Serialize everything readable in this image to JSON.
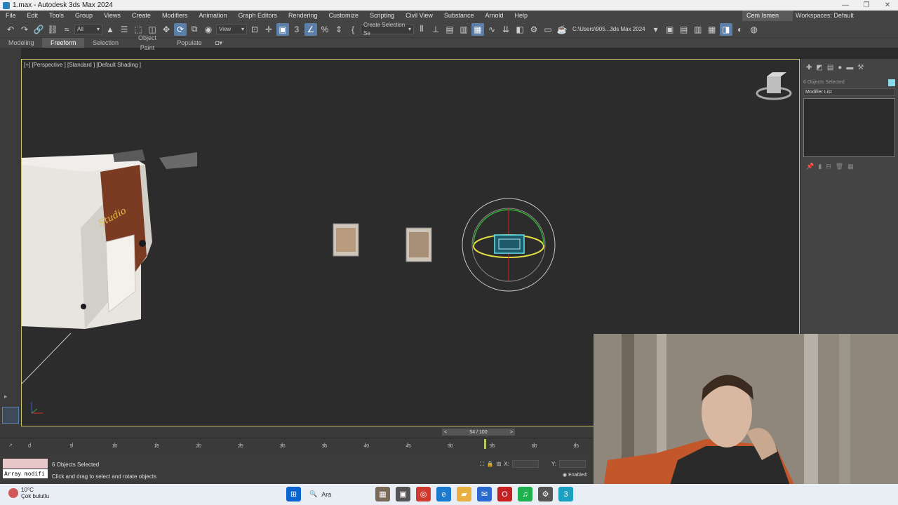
{
  "title_bar": {
    "title": "1.max - Autodesk 3ds Max 2024"
  },
  "menu": {
    "items": [
      "File",
      "Edit",
      "Tools",
      "Group",
      "Views",
      "Create",
      "Modifiers",
      "Animation",
      "Graph Editors",
      "Rendering",
      "Customize",
      "Scripting",
      "Civil View",
      "Substance",
      "Arnold",
      "Help"
    ],
    "user": "Cem Ismen",
    "workspace_label": "Workspaces:",
    "workspace_value": "Default"
  },
  "toolbar": {
    "filter_value": "All",
    "ref_coord_value": "View",
    "selection_set_value": "Create Selection Se",
    "project_path": "C:\\Users\\905...3ds Max 2024"
  },
  "ribbon": {
    "tabs": [
      "Modeling",
      "Freeform",
      "Selection",
      "Object Paint",
      "Populate"
    ],
    "active": "Freeform"
  },
  "viewport": {
    "label": "[+] [Perspective ] [Standard ] [Default Shading ]"
  },
  "command_panel": {
    "selection_text": "6 Objects Selected",
    "modifier_list": "Modifier List"
  },
  "timeline": {
    "slider_text": "54 / 100",
    "ticks": [
      "0",
      "5",
      "10",
      "15",
      "20",
      "25",
      "30",
      "35",
      "40",
      "45",
      "50",
      "55",
      "60",
      "65"
    ]
  },
  "status": {
    "maxscript_value": "Array modifi",
    "selected": "6 Objects Selected",
    "prompt": "Click and drag to select and rotate objects",
    "x_label": "X:",
    "y_label": "Y:",
    "enabled_label": "Enabled:"
  },
  "taskbar": {
    "temperature": "10°C",
    "weather": "Çok bulutlu",
    "search_label": "Ara"
  },
  "colors": {
    "viewport_border": "#c8c86a",
    "selection": "#5ee6f0",
    "active_tool": "#5b7fa8"
  }
}
